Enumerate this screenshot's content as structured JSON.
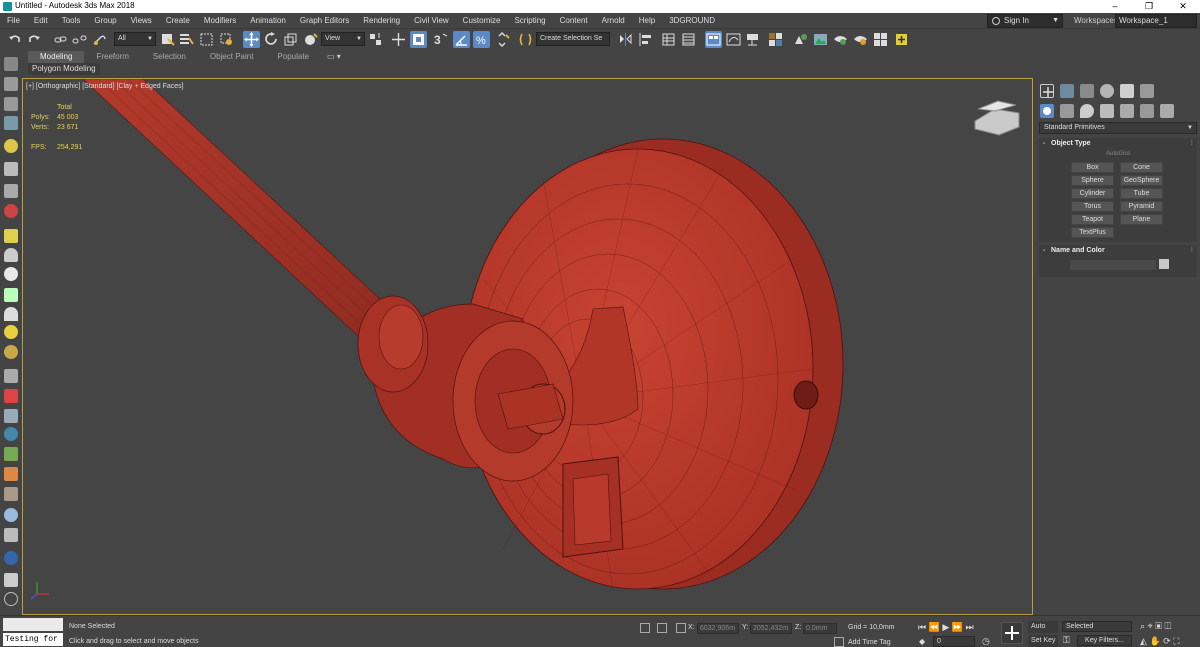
{
  "window": {
    "title": "Untitled - Autodesk 3ds Max 2018",
    "controls": [
      "–",
      "❐",
      "✕"
    ]
  },
  "menu": {
    "items": [
      "File",
      "Edit",
      "Tools",
      "Group",
      "Views",
      "Create",
      "Modifiers",
      "Animation",
      "Graph Editors",
      "Rendering",
      "Civil View",
      "Customize",
      "Scripting",
      "Content",
      "Arnold",
      "Help",
      "3DGROUND"
    ],
    "sign_in": "Sign In",
    "workspaces_label": "Workspaces:",
    "workspace_value": "Workspace_1"
  },
  "toolbar": {
    "selection_filter": "All",
    "reference_coord": "View",
    "named_selection": "Create Selection Se"
  },
  "ribbon": {
    "tabs": [
      "Modeling",
      "Freeform",
      "Selection",
      "Object Paint",
      "Populate"
    ],
    "active_tab": "Modeling",
    "sub_label": "Polygon Modeling"
  },
  "viewport": {
    "label": "[+] [Orthographic] [Standard] [Clay + Edged Faces]",
    "stats": {
      "total_label": "Total",
      "polys_label": "Polys:",
      "polys_value": "45 003",
      "verts_label": "Verts:",
      "verts_value": "23 671",
      "fps_label": "FPS:",
      "fps_value": "254,291"
    }
  },
  "command_panel": {
    "dropdown": "Standard Primitives",
    "object_type": {
      "title": "Object Type",
      "autogrid": "AutoGrid",
      "buttons": [
        "Box",
        "Cone",
        "Sphere",
        "GeoSphere",
        "Cylinder",
        "Tube",
        "Torus",
        "Pyramid",
        "Teapot",
        "Plane",
        "TextPlus"
      ]
    },
    "name_and_color": {
      "title": "Name and Color"
    }
  },
  "status": {
    "maxscript_input": "Testing for :",
    "selection": "None Selected",
    "prompt": "Click and drag to select and move objects",
    "x_label": "X:",
    "x_value": "6032,906m",
    "y_label": "Y:",
    "y_value": "2052,432m",
    "z_label": "Z:",
    "z_value": "0,0mm",
    "grid": "Grid = 10,0mm",
    "add_time_tag": "Add Time Tag",
    "frame": "0",
    "auto_key": "Auto Key",
    "set_key": "Set Key",
    "selected_dropdown": "Selected",
    "key_filters": "Key Filters..."
  },
  "colors": {
    "model": "#b8392c",
    "accent": "#5b8ac6",
    "viewport_border": "#b8a13a",
    "stats_text": "#e3d25a"
  }
}
